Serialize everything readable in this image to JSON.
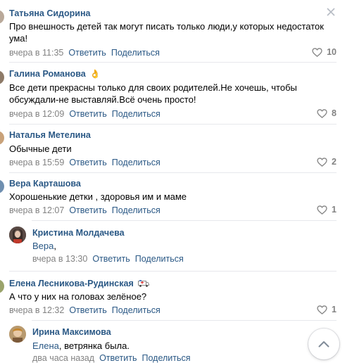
{
  "actions": {
    "reply": "Ответить",
    "share": "Поделиться"
  },
  "comments": [
    {
      "author": "Татьяна Сидорина",
      "text_line1": "Про внешность детей так могут писать только люди,у которых недостаток",
      "text_line2": "ума!",
      "time": "вчера в 11:35",
      "likes": "10"
    },
    {
      "author": "Галина Романова",
      "author_emoji": "👌",
      "text_line1": "Все дети прекрасны только для своих родителей.Не хочешь, чтобы",
      "text_line2": "обсуждали-не выставляй.Всё очень просто!",
      "time": "вчера в 12:09",
      "likes": "8"
    },
    {
      "author": "Наталья Метелина",
      "text_line1": "Обычные дети",
      "time": "вчера в 15:59",
      "likes": "2"
    },
    {
      "author": "Вера Карташова",
      "text_line1": "Хорошенькие детки , здоровья им и маме",
      "time": "вчера в 12:07",
      "likes": "1"
    },
    {
      "author": "Кристина Молдачева",
      "mention": "Вера",
      "text_rest": ",",
      "time": "вчера в 13:30"
    },
    {
      "author": "Елена Лесникова-Рудинская",
      "text_line1": "А что у них на головах зелёное?",
      "time": "вчера в 12:32",
      "likes": "1"
    },
    {
      "author": "Ирина Максимова",
      "mention": "Елена",
      "text_rest": ", ветрянка была.",
      "time": "два часа назад"
    }
  ],
  "icons": {
    "close": "close-icon",
    "like": "heart-icon",
    "scroll_up": "chevron-up-icon"
  },
  "colors": {
    "link": "#2a5885",
    "meta": "#828282",
    "divider": "#e7e8ec"
  }
}
